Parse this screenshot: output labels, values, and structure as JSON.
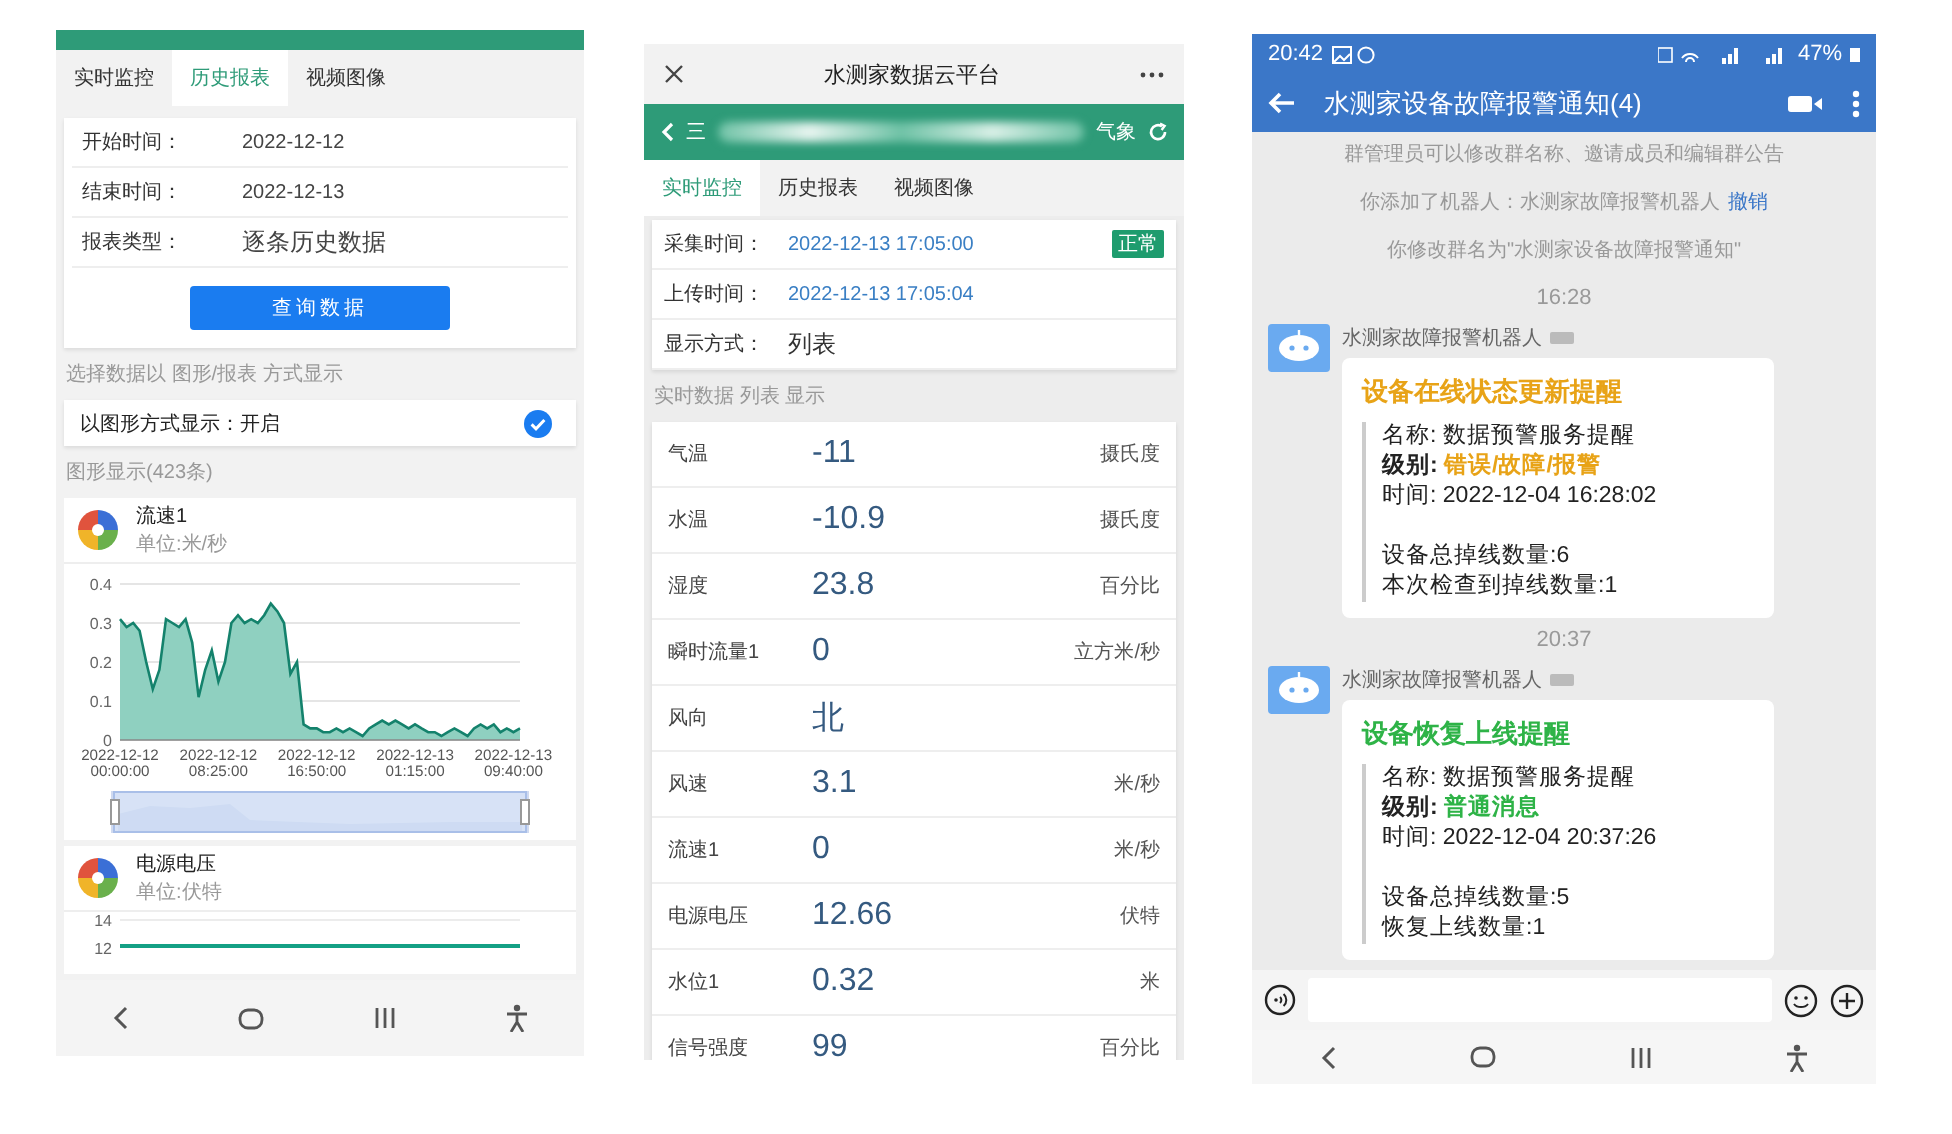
{
  "left": {
    "tabs": [
      {
        "label": "实时监控",
        "selected": false
      },
      {
        "label": "历史报表",
        "selected": true
      },
      {
        "label": "视频图像",
        "selected": false
      }
    ],
    "form": [
      {
        "label": "开始时间：",
        "value": "2022-12-12",
        "kind": "date"
      },
      {
        "label": "结束时间：",
        "value": "2022-12-13",
        "kind": "date"
      },
      {
        "label": "报表类型：",
        "value": "逐条历史数据",
        "kind": "select"
      }
    ],
    "query_button": "查询数据",
    "display_hint": "选择数据以 图形/报表 方式显示",
    "graph_toggle": {
      "label": "以图形方式显示：开启",
      "checked": true
    },
    "graph_count": "图形显示(423条)",
    "charts": [
      {
        "unit": "单位:米/秒",
        "zoom_slider": {
          "level": 1
        },
        "chart_data": {
          "type": "area",
          "title": "流速1",
          "grid": true,
          "yticks": [
            0,
            0.1,
            0.2,
            0.3,
            0.4
          ],
          "ylim": [
            0,
            0.4
          ],
          "categories": [
            "2022-12-12 00:00:00",
            null,
            null,
            null,
            null,
            null,
            null,
            null,
            null,
            null,
            null,
            null,
            null,
            null,
            null,
            "2022-12-12 08:25:00",
            null,
            null,
            null,
            null,
            null,
            null,
            null,
            null,
            null,
            null,
            null,
            null,
            null,
            null,
            "2022-12-12 16:50:00",
            null,
            null,
            null,
            null,
            null,
            null,
            null,
            null,
            null,
            null,
            null,
            null,
            null,
            null,
            "2022-12-13 01:15:00",
            null,
            null,
            null,
            null,
            null,
            null,
            null,
            null,
            null,
            null,
            null,
            null,
            null,
            null,
            "2022-12-13 09:40:00",
            null
          ],
          "values": [
            0.31,
            0.29,
            0.3,
            0.28,
            0.2,
            0.13,
            0.18,
            0.31,
            0.3,
            0.29,
            0.31,
            0.25,
            0.11,
            0.18,
            0.23,
            0.15,
            0.2,
            0.3,
            0.32,
            0.3,
            0.31,
            0.3,
            0.32,
            0.35,
            0.33,
            0.3,
            0.17,
            0.2,
            0.04,
            0.03,
            0.03,
            0.02,
            0.02,
            0.03,
            0.02,
            0.03,
            0.02,
            0.01,
            0.03,
            0.04,
            0.05,
            0.04,
            0.05,
            0.04,
            0.03,
            0.04,
            0.03,
            0.02,
            0.02,
            0.01,
            0.02,
            0.03,
            0.02,
            0.01,
            0.03,
            0.04,
            0.03,
            0.04,
            0.02,
            0.03,
            0.02,
            0.03
          ]
        }
      },
      {
        "title": "电源电压",
        "unit": "单位:伏特",
        "axis_labels": [
          "14",
          "12"
        ]
      }
    ]
  },
  "middle": {
    "title": "水测家数据云平台",
    "header_fragments": [
      "三",
      "气象"
    ],
    "tabs": [
      {
        "label": "实时监控",
        "selected": true
      },
      {
        "label": "历史报表",
        "selected": false
      },
      {
        "label": "视频图像",
        "selected": false
      }
    ],
    "info": [
      {
        "label": "采集时间：",
        "value": "2022-12-13 17:05:00",
        "kind": "time",
        "badge": "正常"
      },
      {
        "label": "上传时间：",
        "value": "2022-12-13 17:05:04",
        "kind": "time"
      },
      {
        "label": "显示方式：",
        "value": "列表",
        "kind": "plain"
      }
    ],
    "list_hint": "实时数据 列表 显示",
    "readings": [
      {
        "name": "气温",
        "value": "-11",
        "unit": "摄氏度"
      },
      {
        "name": "水温",
        "value": "-10.9",
        "unit": "摄氏度"
      },
      {
        "name": "湿度",
        "value": "23.8",
        "unit": "百分比"
      },
      {
        "name": "瞬时流量1",
        "value": "0",
        "unit": "立方米/秒"
      },
      {
        "name": "风向",
        "value": "北"
      },
      {
        "name": "风速",
        "value": "3.1",
        "unit": "米/秒"
      },
      {
        "name": "流速1",
        "value": "0",
        "unit": "米/秒"
      },
      {
        "name": "电源电压",
        "value": "12.66",
        "unit": "伏特"
      },
      {
        "name": "水位1",
        "value": "0.32",
        "unit": "米"
      },
      {
        "name": "信号强度",
        "value": "99",
        "unit": "百分比"
      }
    ]
  },
  "right": {
    "status_time": "20:42",
    "battery": "47%",
    "title": "水测家设备故障报警通知(4)",
    "system_messages": [
      {
        "text": "群管理员可以修改群名称、邀请成员和编辑群公告"
      },
      {
        "text": "你添加了机器人：水测家故障报警机器人",
        "link": "撤销"
      },
      {
        "text": "你修改群名为\"水测家设备故障报警通知\""
      }
    ],
    "messages": [
      {
        "time": "16:28",
        "sender": "水测家故障报警机器人",
        "title": "设备在线状态更新提醒",
        "color": "#e8a317",
        "fields": [
          {
            "label": "名称:",
            "value": "数据预警服务提醒",
            "kind": "plain"
          },
          {
            "label": "级别:",
            "value": "错误/故障/报警",
            "kind": "level"
          },
          {
            "label": "时间:",
            "value": "2022-12-04 16:28:02",
            "kind": "plain"
          }
        ],
        "counts": [
          "设备总掉线数量:6",
          "本次检查到掉线数量:1"
        ]
      },
      {
        "time": "20:37",
        "sender": "水测家故障报警机器人",
        "title": "设备恢复上线提醒",
        "color": "#2eb347",
        "fields": [
          {
            "label": "名称:",
            "value": "数据预警服务提醒",
            "kind": "plain"
          },
          {
            "label": "级别:",
            "value": "普通消息",
            "kind": "level"
          },
          {
            "label": "时间:",
            "value": "2022-12-04 20:37:26",
            "kind": "plain"
          }
        ],
        "counts": [
          "设备总掉线数量:5",
          "恢复上线数量:1"
        ]
      }
    ]
  }
}
